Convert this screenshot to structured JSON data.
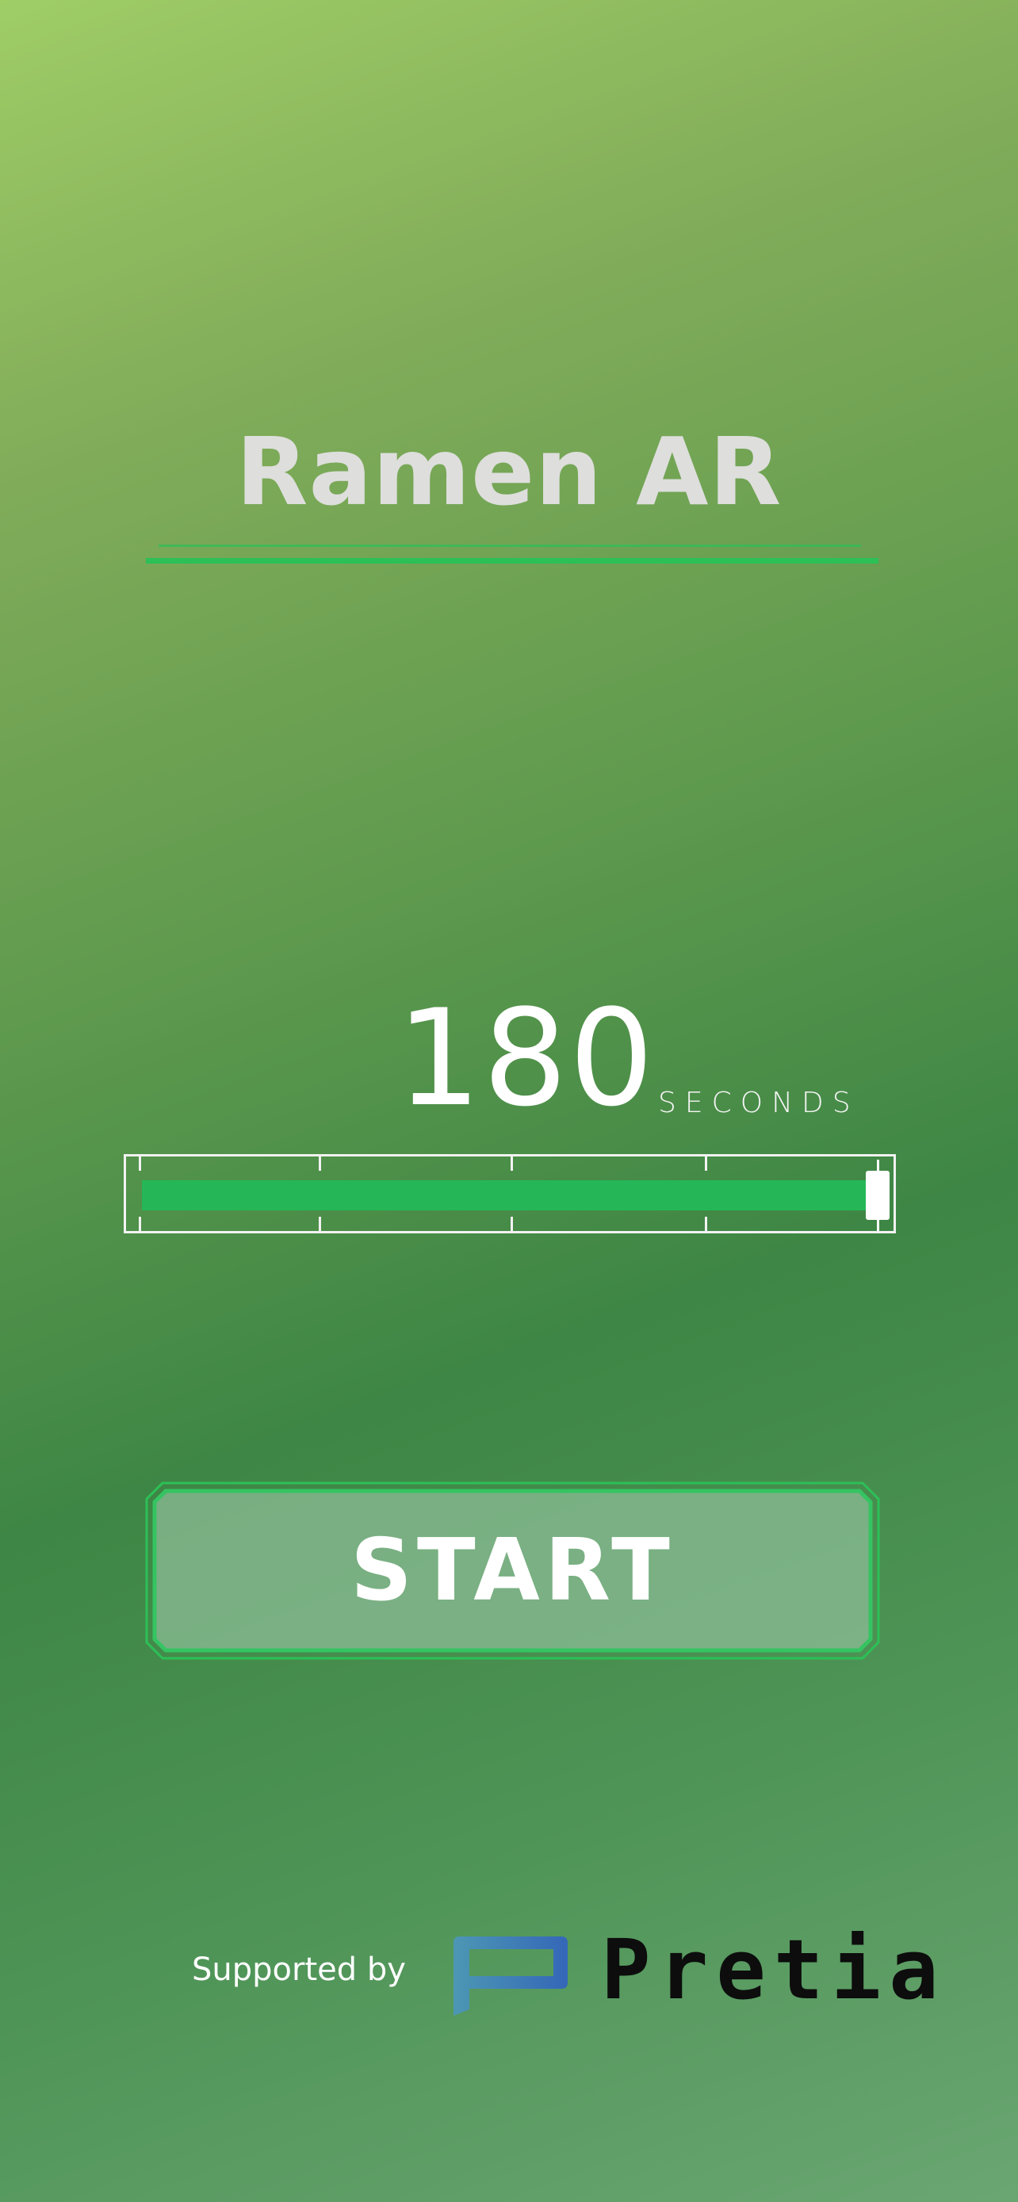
{
  "app": {
    "title": "Ramen AR"
  },
  "timer": {
    "value": "180",
    "unit": "SECONDS",
    "fill_fraction": 1.0
  },
  "start_button": {
    "label": "START"
  },
  "footer": {
    "supported_by": "Supported by",
    "sponsor_name": "Pretia"
  },
  "colors": {
    "accent_green": "#2cc057",
    "title_text": "#dededc",
    "logo_blue": "#3a6fb8"
  },
  "icons": {
    "sponsor_logo": "pretia-logo-icon"
  }
}
